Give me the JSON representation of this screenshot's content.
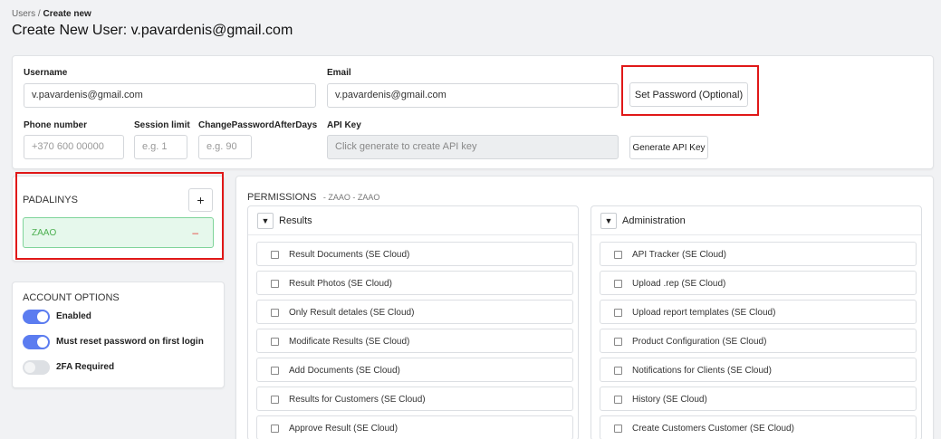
{
  "breadcrumb": {
    "parent": "Users",
    "separator": " / ",
    "current": "Create new"
  },
  "page_title": "Create New User: v.pavardenis@gmail.com",
  "form": {
    "username_label": "Username",
    "username_value": "v.pavardenis@gmail.com",
    "email_label": "Email",
    "email_value": "v.pavardenis@gmail.com",
    "set_password_label": "Set Password (Optional)",
    "phone_label": "Phone number",
    "phone_placeholder": "+370 600 00000",
    "session_limit_label": "Session limit",
    "session_limit_placeholder": "e.g. 1",
    "change_password_label": "ChangePasswordAfterDays",
    "change_password_placeholder": "e.g. 90",
    "api_key_label": "API Key",
    "api_key_placeholder": "Click generate to create API key",
    "generate_api_key_label": "Generate API Key"
  },
  "companies": {
    "title": "PADALINYS",
    "add_label": "+",
    "items": [
      {
        "name": "ZAAO",
        "remove_label": "–"
      }
    ]
  },
  "account_options": {
    "title": "ACCOUNT OPTIONS",
    "toggles": [
      {
        "label": "Enabled",
        "on": true
      },
      {
        "label": "Must reset password on first login",
        "on": true
      },
      {
        "label": "2FA Required",
        "on": false
      }
    ]
  },
  "permissions": {
    "title": "PERMISSIONS",
    "subtitle": "- ZAAO - ZAAO",
    "groups": [
      {
        "caret": "▼",
        "title": "Results",
        "items": [
          "Result Documents (SE Cloud)",
          "Result Photos (SE Cloud)",
          "Only Result detales (SE Cloud)",
          "Modificate Results (SE Cloud)",
          "Add Documents (SE Cloud)",
          "Results for Customers (SE Cloud)",
          "Approve Result (SE Cloud)"
        ]
      },
      {
        "caret": "▼",
        "title": "Administration",
        "items": [
          "API Tracker (SE Cloud)",
          "Upload .rep (SE Cloud)",
          "Upload report templates (SE Cloud)",
          "Product Configuration (SE Cloud)",
          "Notifications for Clients (SE Cloud)",
          "History (SE Cloud)",
          "Create Customers Customer (SE Cloud)"
        ]
      }
    ]
  },
  "colors": {
    "highlight": "#e01818",
    "toggle_on": "#5b7cf0",
    "company_bg": "#e6f8ec",
    "company_text": "#4caf50",
    "remove": "#e53935"
  }
}
